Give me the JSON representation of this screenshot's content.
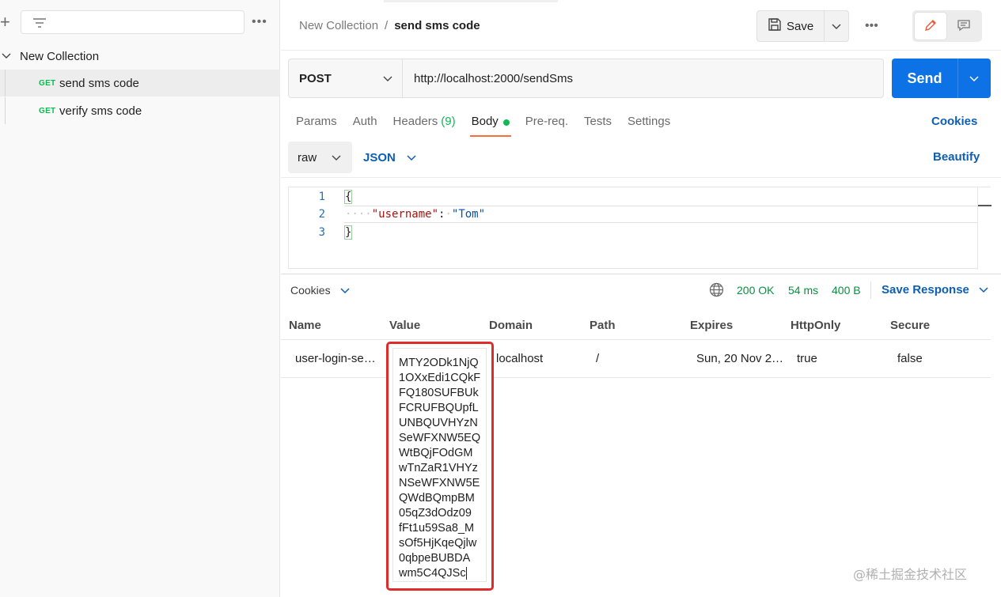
{
  "sidebar": {
    "more_label": "•••",
    "collection_name": "New Collection",
    "items": [
      {
        "method": "GET",
        "name": "send sms code"
      },
      {
        "method": "GET",
        "name": "verify sms code"
      }
    ]
  },
  "header": {
    "breadcrumb_parent": "New Collection",
    "breadcrumb_sep": "/",
    "breadcrumb_current": "send sms code",
    "save_label": "Save",
    "more_label": "•••"
  },
  "request": {
    "method": "POST",
    "url": "http://localhost:2000/sendSms",
    "send_label": "Send",
    "tabs": [
      {
        "label": "Params"
      },
      {
        "label": "Auth"
      },
      {
        "label": "Headers",
        "count": "(9)"
      },
      {
        "label": "Body"
      },
      {
        "label": "Pre-req."
      },
      {
        "label": "Tests"
      },
      {
        "label": "Settings"
      }
    ],
    "cookies_link": "Cookies",
    "body_mode": "raw",
    "body_lang": "JSON",
    "beautify_link": "Beautify",
    "code": [
      {
        "ln": "1",
        "open": "{"
      },
      {
        "ln": "2",
        "key": "\"username\"",
        "colon": ":",
        "value": "\"Tom\""
      },
      {
        "ln": "3",
        "close": "}"
      }
    ]
  },
  "response": {
    "tab_label": "Cookies",
    "status": "200 OK",
    "time": "54 ms",
    "size": "400 B",
    "save_response": "Save Response",
    "columns": [
      "Name",
      "Value",
      "Domain",
      "Path",
      "Expires",
      "HttpOnly",
      "Secure"
    ],
    "row": {
      "name": "user-login-se…",
      "value_lines": [
        "MTY2ODk1NjQ",
        "1OXxEdi1CQkF",
        "FQ180SUFBUk",
        "FCRUFBQUpfL",
        "UNBQUVHYzN",
        "SeWFXNW5EQ",
        "WtBQjFOdGM",
        "wTnZaR1VHYz",
        "NSeWFXNW5E",
        "QWdBQmpBM",
        "05qZ3dOdz09",
        "fFt1u59Sa8_M",
        "sOf5HjKqeQjlw",
        "0qbpeBUBDA",
        "wm5C4QJSc"
      ],
      "domain": "localhost",
      "path": "/",
      "expires": "Sun, 20 Nov 2…",
      "httponly": "true",
      "secure": "false"
    }
  },
  "watermark": "@稀土掘金技术社区",
  "colors": {
    "accent": "#ff6c37",
    "send": "#0d72e5",
    "get": "#0cbb52",
    "link": "#0d5fb3",
    "highlight_box": "#e02b2b"
  }
}
